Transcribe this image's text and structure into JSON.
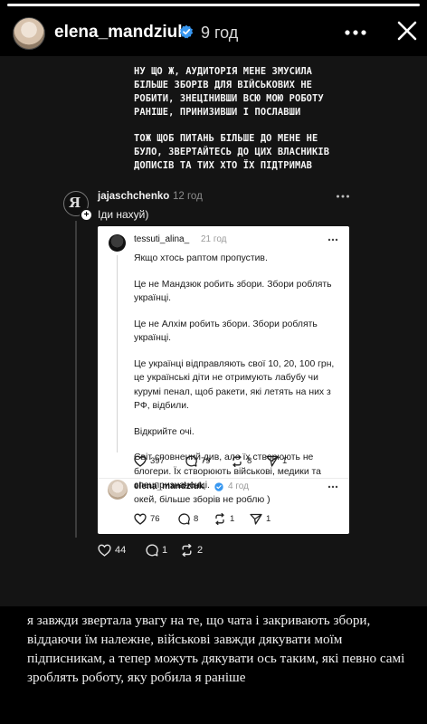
{
  "story": {
    "progress_fraction": 1.0,
    "header": {
      "username": "elena_mandziuk",
      "time": "9 год",
      "more_icon": "more-horizontal-icon",
      "close_icon": "close-icon",
      "verified_icon": "verified-badge-icon"
    },
    "caption_top": [
      "НУ ЩО Ж, АУДИТОРІЯ МЕНЕ ЗМУСИЛА БІЛЬШЕ ЗБОРІВ ДЛЯ ВІЙСЬКОВИХ НЕ РОБИТИ, ЗНЕЦІНИВШИ ВСЮ МОЮ РОБОТУ РАНІШЕ, ПРИНИЗИВШИ І ПОСЛАВШИ",
      "ТОЖ ЩОБ ПИТАНЬ БІЛЬШЕ ДО МЕНЕ НЕ БУЛО, ЗВЕРТАЙТЕСЬ ДО ЦИХ ВЛАСНИКІВ ДОПИСІВ ТА ТИХ ХТО ЇХ ПІДТРИМАВ"
    ],
    "caption_bottom": "я завжди звертала увагу на те, що чата і закривають збори, віддаючи їм належне, військові завжди дякувати моїм підписникам, а тепер можуть дякувати ось таким, які певно самі зроблять роботу, яку робила я раніше"
  },
  "reply": {
    "avatar_letter": "Я",
    "username": "jajaschchenko",
    "time": "12 год",
    "text": "Іди нахуй)",
    "actions": {
      "likes": "44",
      "comments": "1",
      "reposts": "2"
    }
  },
  "quoted_post": {
    "username": "tessuti_alina_",
    "time": "21 год",
    "paragraphs": [
      "Якщо хтось раптом пропустив.",
      "Це не Мандзюк робить збори. Збори роблять українці.",
      "Це не Алхім робить збори. Збори роблять українці.",
      "Це українці відправляють свої 10, 20, 100 грн, це українські діти не отримують лабубу чи курумі пенал, щоб ракети, які летять на них з РФ, відбили.",
      "Відкрийте очі.",
      "Світ сповнений див, але їх створюють не блогери. Їх створюють військові, медики та спецпризначенці."
    ],
    "actions": {
      "likes": "397",
      "comments": "79",
      "reposts": "8",
      "shares": "1"
    }
  },
  "quoted_reply": {
    "username": "elena_mandziuk",
    "time": "4 год",
    "text": "окей, більше зборів не роблю )",
    "actions": {
      "likes": "76",
      "comments": "8",
      "reposts": "1",
      "shares": "1"
    }
  },
  "colors": {
    "background": "#000000",
    "story_area": "#141414",
    "verified_blue": "#3897f0",
    "card": "#ffffff"
  }
}
